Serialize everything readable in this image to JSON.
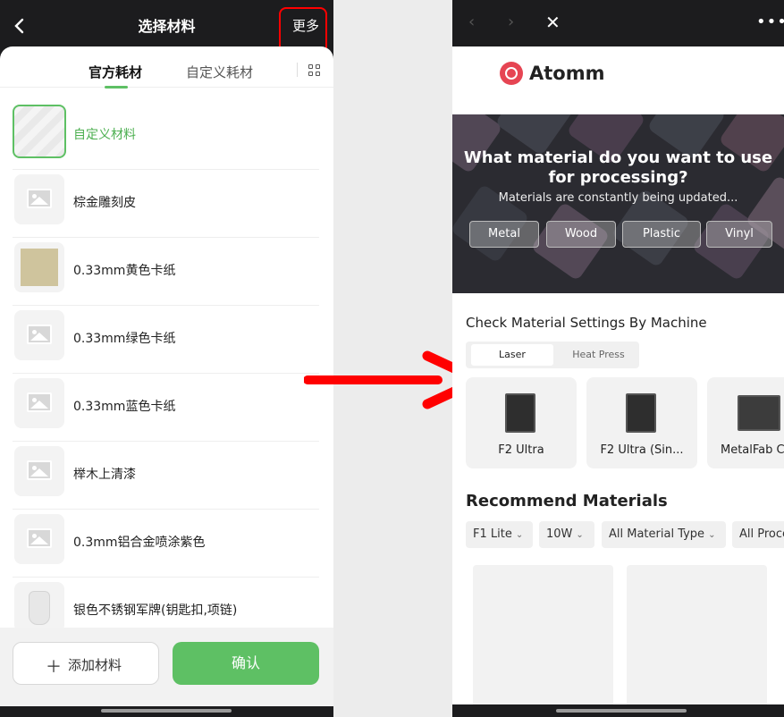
{
  "left_app": {
    "title": "选择材料",
    "back_icon": "chevron-left-icon",
    "more_label": "更多",
    "tabs": {
      "official": "官方耗材",
      "custom": "自定义耗材",
      "grid_icon": "grid-icon"
    },
    "materials": [
      {
        "label": "自定义材料",
        "selected": true,
        "thumb": "pattern"
      },
      {
        "label": "棕金雕刻皮",
        "selected": false,
        "thumb": "placeholder"
      },
      {
        "label": "0.33mm黄色卡纸",
        "selected": false,
        "thumb": "swatch"
      },
      {
        "label": "0.33mm绿色卡纸",
        "selected": false,
        "thumb": "placeholder"
      },
      {
        "label": "0.33mm蓝色卡纸",
        "selected": false,
        "thumb": "placeholder"
      },
      {
        "label": "榉木上清漆",
        "selected": false,
        "thumb": "placeholder"
      },
      {
        "label": "0.3mm铝合金喷涂紫色",
        "selected": false,
        "thumb": "placeholder"
      },
      {
        "label": "银色不锈钢军牌(钥匙扣,项链)",
        "selected": false,
        "thumb": "tag"
      }
    ],
    "add_button": "添加材料",
    "confirm_button": "确认",
    "accent_color": "#5ec064"
  },
  "right_app": {
    "nav": {
      "prev": "‹",
      "next": "›",
      "close": "✕",
      "menu": "•••"
    },
    "brand": "Atomm",
    "hero": {
      "title": "What material do you want to use for processing?",
      "subtitle": "Materials are constantly being updated...",
      "chips": [
        "Metal",
        "Wood",
        "Plastic",
        "Vinyl"
      ]
    },
    "machine_section": {
      "title": "Check Material Settings By Machine",
      "segments": [
        "Laser",
        "Heat Press"
      ],
      "machines": [
        "F2 Ultra",
        "F2 Ultra (Sin...",
        "MetalFab C"
      ]
    },
    "recommend": {
      "title": "Recommend Materials",
      "filters": [
        "F1 Lite",
        "10W",
        "All Material Type",
        "All Proce"
      ]
    }
  },
  "annotation_arrow_color": "#ff0000"
}
